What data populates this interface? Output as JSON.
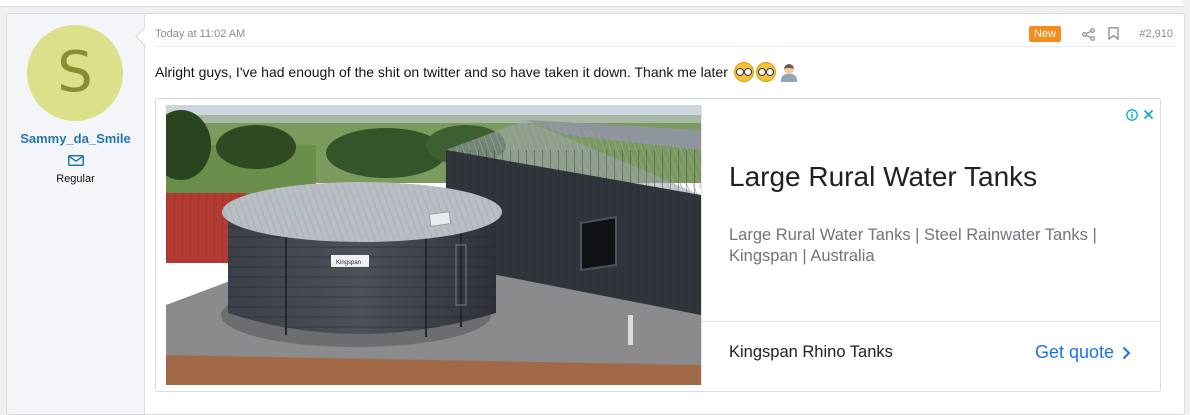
{
  "user": {
    "avatar_letter": "S",
    "username": "Sammy_da_Smile",
    "user_title": "Regular"
  },
  "post": {
    "timestamp": "Today at 11:02 AM",
    "new_badge": "New",
    "post_number": "#2,910",
    "message": "Alright guys, I've had enough of the shit on twitter and so have taken it down. Thank me later"
  },
  "ad": {
    "headline": "Large Rural Water Tanks",
    "description": "Large Rural Water Tanks | Steel Rainwater Tanks | Kingspan | Australia",
    "advertiser": "Kingspan Rhino Tanks",
    "cta_label": "Get quote",
    "tank_label": "Kingspan"
  },
  "colors": {
    "avatar_bg": "#dde08a",
    "username": "#2577b1",
    "new_badge": "#f78c1e",
    "cta": "#1a73e8"
  },
  "icons": [
    "envelope-icon",
    "share-icon",
    "bookmark-icon",
    "info-icon",
    "close-icon",
    "chevron-right-icon"
  ]
}
